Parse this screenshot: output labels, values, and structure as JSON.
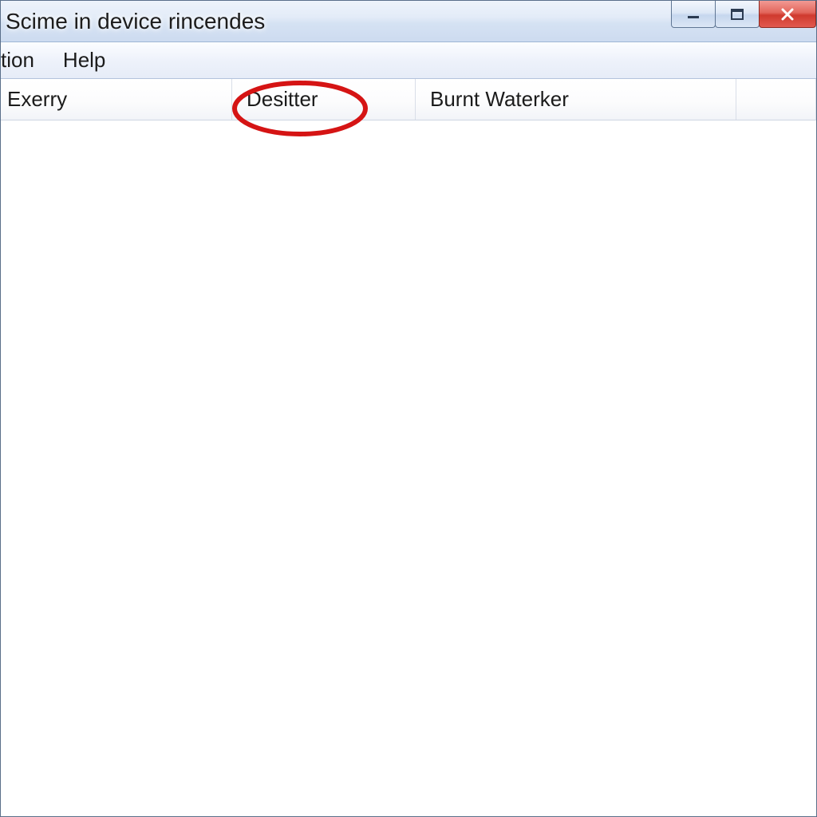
{
  "titlebar": {
    "title": "Scime in device rincendes"
  },
  "menubar": {
    "items": [
      {
        "label": "tion"
      },
      {
        "label": "Help"
      }
    ]
  },
  "columns": [
    {
      "label": "Exerry"
    },
    {
      "label": "Desitter"
    },
    {
      "label": "Burnt Waterker"
    },
    {
      "label": ""
    }
  ],
  "annotation": {
    "circled_column_index": 1
  }
}
